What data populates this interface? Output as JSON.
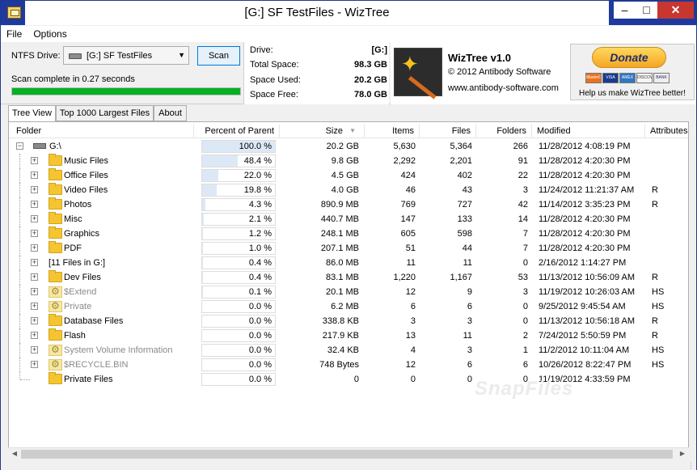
{
  "window": {
    "title": "[G:] SF TestFiles  - WizTree"
  },
  "menu": {
    "file": "File",
    "options": "Options"
  },
  "scan_panel": {
    "drive_label": "NTFS Drive:",
    "drive_value": "[G:] SF TestFiles",
    "scan_button": "Scan",
    "status": "Scan complete in 0.27 seconds",
    "progress_fraction": 1.0
  },
  "drive_info": {
    "drive_label": "Drive:",
    "drive_value": "[G:]",
    "total_label": "Total Space:",
    "total_value": "98.3 GB",
    "used_label": "Space Used:",
    "used_value": "20.2 GB",
    "free_label": "Space Free:",
    "free_value": "78.0 GB"
  },
  "about": {
    "app_name": "WizTree v1.0",
    "copyright": "© 2012 Antibody Software",
    "website": "www.antibody-software.com",
    "donate_button": "Donate",
    "donate_caption": "Help us make WizTree better!",
    "cards": [
      "MasterCard",
      "VISA",
      "AMEX",
      "DISCOVER",
      "BANK"
    ]
  },
  "tabs": [
    "Tree View",
    "Top 1000 Largest Files",
    "About"
  ],
  "columns": {
    "folder": "Folder",
    "percent": "Percent of Parent",
    "size": "Size",
    "items": "Items",
    "files": "Files",
    "folders": "Folders",
    "modified": "Modified",
    "attributes": "Attributes"
  },
  "rows": [
    {
      "name": "G:\\",
      "pct": "100.0 %",
      "pct_value": 100.0,
      "size": "20.2 GB",
      "items": "5,630",
      "files": "5,364",
      "folders": "266",
      "modified": "11/28/2012 4:08:19 PM",
      "attr": "",
      "kind": "drive",
      "expand": "-"
    },
    {
      "name": "Music Files",
      "pct": "48.4 %",
      "pct_value": 48.4,
      "size": "9.8 GB",
      "items": "2,292",
      "files": "2,201",
      "folders": "91",
      "modified": "11/28/2012 4:20:30 PM",
      "attr": "",
      "kind": "folder",
      "expand": "+"
    },
    {
      "name": "Office Files",
      "pct": "22.0 %",
      "pct_value": 22.0,
      "size": "4.5 GB",
      "items": "424",
      "files": "402",
      "folders": "22",
      "modified": "11/28/2012 4:20:30 PM",
      "attr": "",
      "kind": "folder",
      "expand": "+"
    },
    {
      "name": "Video Files",
      "pct": "19.8 %",
      "pct_value": 19.8,
      "size": "4.0 GB",
      "items": "46",
      "files": "43",
      "folders": "3",
      "modified": "11/24/2012 11:21:37 AM",
      "attr": "R",
      "kind": "folder",
      "expand": "+"
    },
    {
      "name": "Photos",
      "pct": "4.3 %",
      "pct_value": 4.3,
      "size": "890.9 MB",
      "items": "769",
      "files": "727",
      "folders": "42",
      "modified": "11/14/2012 3:35:23 PM",
      "attr": "R",
      "kind": "folder",
      "expand": "+"
    },
    {
      "name": "Misc",
      "pct": "2.1 %",
      "pct_value": 2.1,
      "size": "440.7 MB",
      "items": "147",
      "files": "133",
      "folders": "14",
      "modified": "11/28/2012 4:20:30 PM",
      "attr": "",
      "kind": "folder",
      "expand": "+"
    },
    {
      "name": "Graphics",
      "pct": "1.2 %",
      "pct_value": 1.2,
      "size": "248.1 MB",
      "items": "605",
      "files": "598",
      "folders": "7",
      "modified": "11/28/2012 4:20:30 PM",
      "attr": "",
      "kind": "folder",
      "expand": "+"
    },
    {
      "name": "PDF",
      "pct": "1.0 %",
      "pct_value": 1.0,
      "size": "207.1 MB",
      "items": "51",
      "files": "44",
      "folders": "7",
      "modified": "11/28/2012 4:20:30 PM",
      "attr": "",
      "kind": "folder",
      "expand": "+"
    },
    {
      "name": "[11 Files in G:]",
      "pct": "0.4 %",
      "pct_value": 0.4,
      "size": "86.0 MB",
      "items": "11",
      "files": "11",
      "folders": "0",
      "modified": "2/16/2012 1:14:27 PM",
      "attr": "",
      "kind": "files",
      "expand": "+"
    },
    {
      "name": "Dev Files",
      "pct": "0.4 %",
      "pct_value": 0.4,
      "size": "83.1 MB",
      "items": "1,220",
      "files": "1,167",
      "folders": "53",
      "modified": "11/13/2012 10:56:09 AM",
      "attr": "R",
      "kind": "folder",
      "expand": "+"
    },
    {
      "name": "$Extend",
      "pct": "0.1 %",
      "pct_value": 0.1,
      "size": "20.1 MB",
      "items": "12",
      "files": "9",
      "folders": "3",
      "modified": "11/19/2012 10:26:03 AM",
      "attr": "HS",
      "kind": "system",
      "expand": "+"
    },
    {
      "name": "Private",
      "pct": "0.0 %",
      "pct_value": 0.0,
      "size": "6.2 MB",
      "items": "6",
      "files": "6",
      "folders": "0",
      "modified": "9/25/2012 9:45:54 AM",
      "attr": "HS",
      "kind": "system",
      "expand": "+"
    },
    {
      "name": "Database Files",
      "pct": "0.0 %",
      "pct_value": 0.0,
      "size": "338.8 KB",
      "items": "3",
      "files": "3",
      "folders": "0",
      "modified": "11/13/2012 10:56:18 AM",
      "attr": "R",
      "kind": "folder",
      "expand": "+"
    },
    {
      "name": "Flash",
      "pct": "0.0 %",
      "pct_value": 0.0,
      "size": "217.9 KB",
      "items": "13",
      "files": "11",
      "folders": "2",
      "modified": "7/24/2012 5:50:59 PM",
      "attr": "R",
      "kind": "folder",
      "expand": "+"
    },
    {
      "name": "System Volume Information",
      "pct": "0.0 %",
      "pct_value": 0.0,
      "size": "32.4 KB",
      "items": "4",
      "files": "3",
      "folders": "1",
      "modified": "11/2/2012 10:11:04 AM",
      "attr": "HS",
      "kind": "system",
      "expand": "+"
    },
    {
      "name": "$RECYCLE.BIN",
      "pct": "0.0 %",
      "pct_value": 0.0,
      "size": "748 Bytes",
      "items": "12",
      "files": "6",
      "folders": "6",
      "modified": "10/26/2012 8:22:47 PM",
      "attr": "HS",
      "kind": "system",
      "expand": "+"
    },
    {
      "name": "Private Files",
      "pct": "0.0 %",
      "pct_value": 0.0,
      "size": "0",
      "items": "0",
      "files": "0",
      "folders": "0",
      "modified": "11/19/2012 4:33:59 PM",
      "attr": "",
      "kind": "folder",
      "expand": ""
    }
  ],
  "watermark": "SnapFiles",
  "colors": {
    "progress": "#06b025",
    "pct_bar": "#dde8f7",
    "system_text": "#8a8a8a",
    "title_bar": "#1e3a9e",
    "close_button": "#c7372f"
  }
}
